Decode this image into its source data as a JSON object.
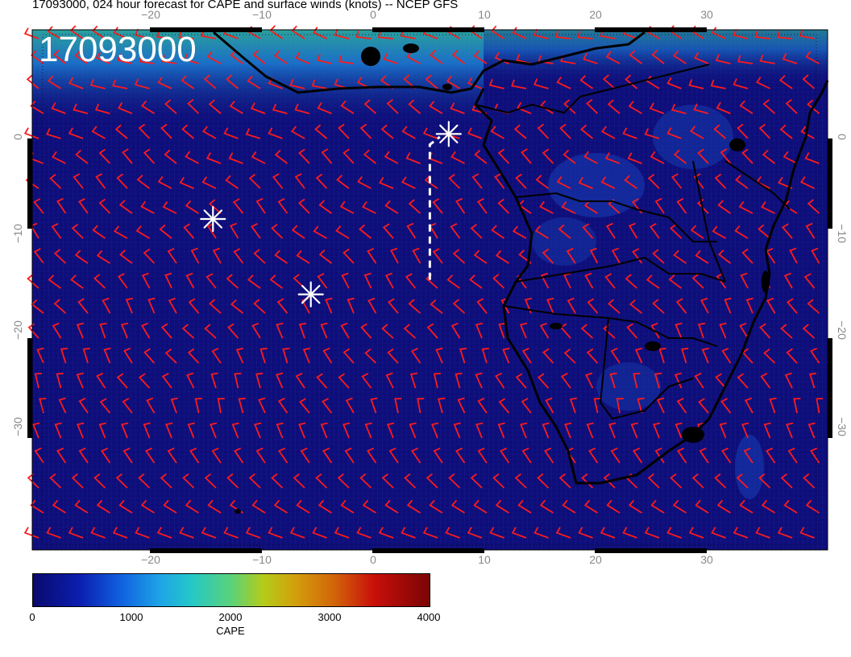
{
  "title": "17093000, 024 hour forecast for CAPE and surface winds (knots) -- NCEP GFS",
  "stamp": "17093000",
  "map": {
    "lon_range": [
      -30,
      42
    ],
    "lat_range": [
      -40,
      10
    ],
    "lon_ticks": [
      "−20",
      "−10",
      "0",
      "10",
      "20",
      "30"
    ],
    "lat_ticks": [
      "0",
      "−10",
      "−20",
      "−30"
    ],
    "field_color": "#0e0e7a",
    "wind_barb_color": "#ff1a1a",
    "coastline_color": "#000000",
    "markers": [
      {
        "type": "asterisk",
        "lon": 6.8,
        "lat": 0.3
      },
      {
        "type": "asterisk",
        "lon": -14.4,
        "lat": -8.5
      },
      {
        "type": "asterisk",
        "lon": -5.6,
        "lat": -16.3
      }
    ],
    "track": [
      [
        5.1,
        -14.8
      ],
      [
        5.1,
        -0.8
      ],
      [
        6.0,
        0.0
      ]
    ]
  },
  "colorbar": {
    "label": "CAPE",
    "min": 0,
    "max": 4000,
    "ticks": [
      "0",
      "1000",
      "2000",
      "3000",
      "4000"
    ]
  }
}
